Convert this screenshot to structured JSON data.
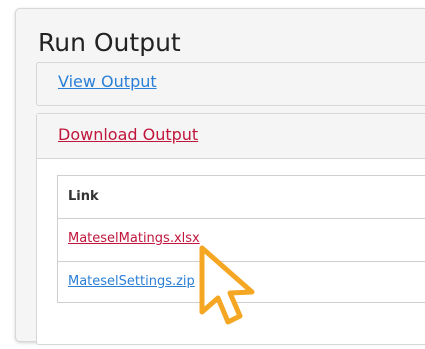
{
  "panel": {
    "title": "Run Output"
  },
  "view_section": {
    "link_label": "View Output"
  },
  "download_section": {
    "link_label": "Download Output",
    "table": {
      "header": "Link",
      "rows": [
        {
          "file": "MateselMatings.xlsx"
        },
        {
          "file": "MateselSettings.zip"
        }
      ]
    }
  },
  "colors": {
    "link_blue": "#2a7fd6",
    "link_active": "#c0163c",
    "cursor": "#f5a623"
  },
  "icons": {
    "cursor": "pointer-cursor-icon"
  }
}
